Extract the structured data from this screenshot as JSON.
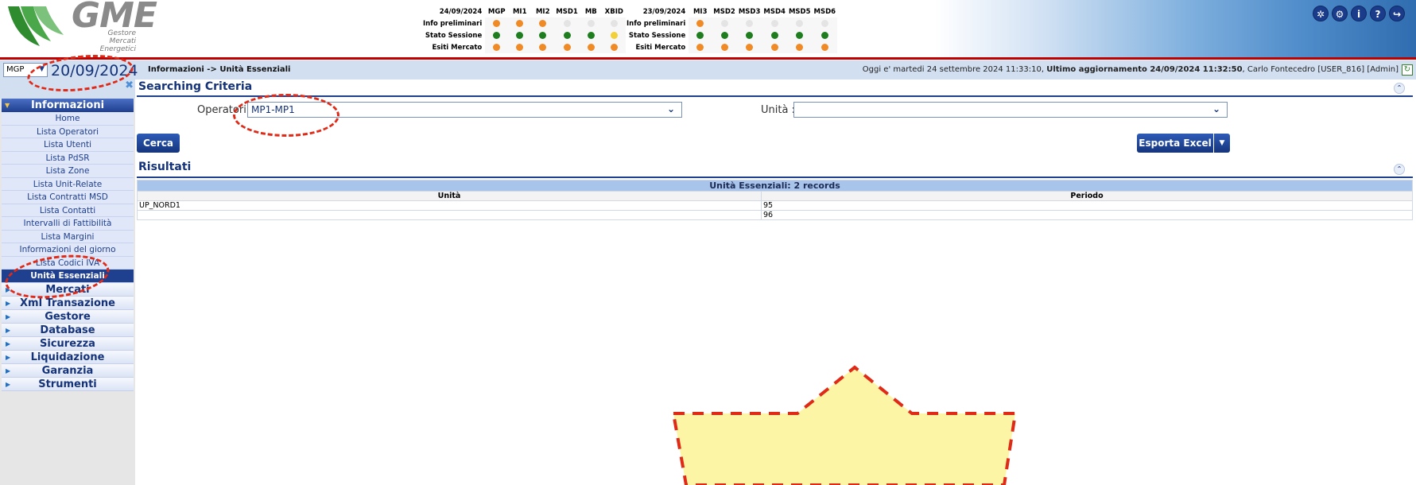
{
  "header": {
    "logo_text": "GME",
    "logo_sub": [
      "Gestore",
      "Mercati",
      "Energetici"
    ],
    "grid1": {
      "date": "24/09/2024",
      "cols": [
        "MGP",
        "MI1",
        "MI2",
        "MSD1",
        "MB",
        "XBID"
      ],
      "rows": [
        {
          "label": "Info preliminari",
          "dots": [
            "o",
            "o",
            "o",
            "w",
            "w",
            "w"
          ]
        },
        {
          "label": "Stato Sessione",
          "dots": [
            "g",
            "g",
            "g",
            "g",
            "g",
            "y"
          ]
        },
        {
          "label": "Esiti Mercato",
          "dots": [
            "o",
            "o",
            "o",
            "o",
            "o",
            "o"
          ]
        }
      ]
    },
    "grid2": {
      "date": "23/09/2024",
      "cols": [
        "MI3",
        "MSD2",
        "MSD3",
        "MSD4",
        "MSD5",
        "MSD6"
      ],
      "rows": [
        {
          "label": "Info preliminari",
          "dots": [
            "o",
            "w",
            "w",
            "w",
            "w",
            "w"
          ]
        },
        {
          "label": "Stato Sessione",
          "dots": [
            "g",
            "g",
            "g",
            "g",
            "g",
            "g"
          ]
        },
        {
          "label": "Esiti Mercato",
          "dots": [
            "o",
            "o",
            "o",
            "o",
            "o",
            "o"
          ]
        }
      ]
    },
    "dot_colors": {
      "o": "#f08a24",
      "g": "#1e7d1e",
      "y": "#f2d03a",
      "w": "#e4e4e4"
    },
    "top_icons": [
      "network-icon",
      "settings-icon",
      "info-icon",
      "help-icon",
      "logout-icon"
    ]
  },
  "toolbar": {
    "market_select": "MGP",
    "date": "20/09/2024",
    "breadcrumb": "Informazioni -> Unità Essenziali",
    "session_prefix": "Oggi e' martedi 24 settembre 2024 11:33:10, ",
    "session_update": "Ultimo aggiornamento 24/09/2024 11:32:50",
    "session_user": ", Carlo Fontecedro [USER_816] [Admin]"
  },
  "sidebar": {
    "section": "Informazioni",
    "items": [
      "Home",
      "Lista Operatori",
      "Lista Utenti",
      "Lista PdSR",
      "Lista Zone",
      "Lista Unit-Relate",
      "Lista Contratti MSD",
      "Lista Contatti",
      "Intervalli di Fattibilità",
      "Lista Margini",
      "Informazioni del giorno",
      "Lista Codici IVA",
      "Unità Essenziali"
    ],
    "active_index": 12,
    "menus": [
      "Mercati",
      "Xml Transazione",
      "Gestore",
      "Database",
      "Sicurezza",
      "Liquidazione",
      "Garanzia",
      "Strumenti"
    ]
  },
  "search": {
    "title": "Searching Criteria",
    "operator_label": "Operatori :",
    "operator_value": "MP1-MP1",
    "unit_label": "Unità :",
    "unit_value": "",
    "search_button": "Cerca",
    "export_button": "Esporta Excel"
  },
  "results": {
    "title": "Risultati",
    "caption": "Unità Essenziali: 2 records",
    "columns": [
      "Unità",
      "Periodo"
    ],
    "rows": [
      [
        "UP_NORD1",
        "95"
      ],
      [
        "",
        "96"
      ]
    ]
  }
}
